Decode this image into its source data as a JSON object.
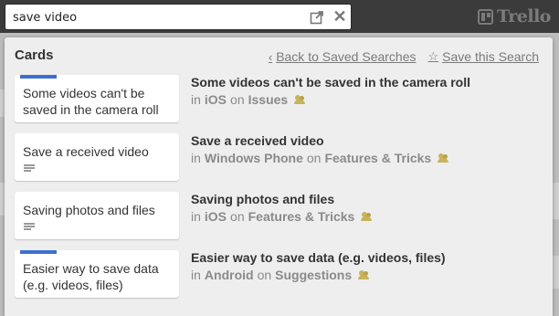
{
  "search": {
    "query": "save video"
  },
  "brand": {
    "name": "Trello"
  },
  "panel": {
    "title": "Cards",
    "back_link": "Back to Saved Searches",
    "save_link": "Save this Search"
  },
  "results": [
    {
      "card_text": "Some videos can't be saved in the camera roll",
      "title": "Some videos can't be saved in the camera roll",
      "in_word": "in",
      "board": "iOS",
      "on_word": "on",
      "list": "Issues",
      "has_label": true,
      "has_description": false
    },
    {
      "card_text": "Save a received video",
      "title": "Save a received video",
      "in_word": "in",
      "board": "Windows Phone",
      "on_word": "on",
      "list": "Features & Tricks",
      "has_label": false,
      "has_description": true
    },
    {
      "card_text": "Saving photos and files",
      "title": "Saving photos and files",
      "in_word": "in",
      "board": "iOS",
      "on_word": "on",
      "list": "Features & Tricks",
      "has_label": false,
      "has_description": true
    },
    {
      "card_text": "Easier way to save data (e.g. videos, files)",
      "title": "Easier way to save data (e.g. videos, files)",
      "in_word": "in",
      "board": "Android",
      "on_word": "on",
      "list": "Suggestions",
      "has_label": true,
      "has_description": false
    }
  ],
  "colors": {
    "label_blue": "#3f6ed3",
    "header": "#3b3b3b",
    "panel": "#eeeeee",
    "team_icon": "#c9b35a"
  },
  "icons": {
    "external": "external-link-icon",
    "close": "close-icon",
    "back": "chevron-left-icon",
    "save": "star-icon",
    "description": "description-icon",
    "team": "team-icon"
  }
}
